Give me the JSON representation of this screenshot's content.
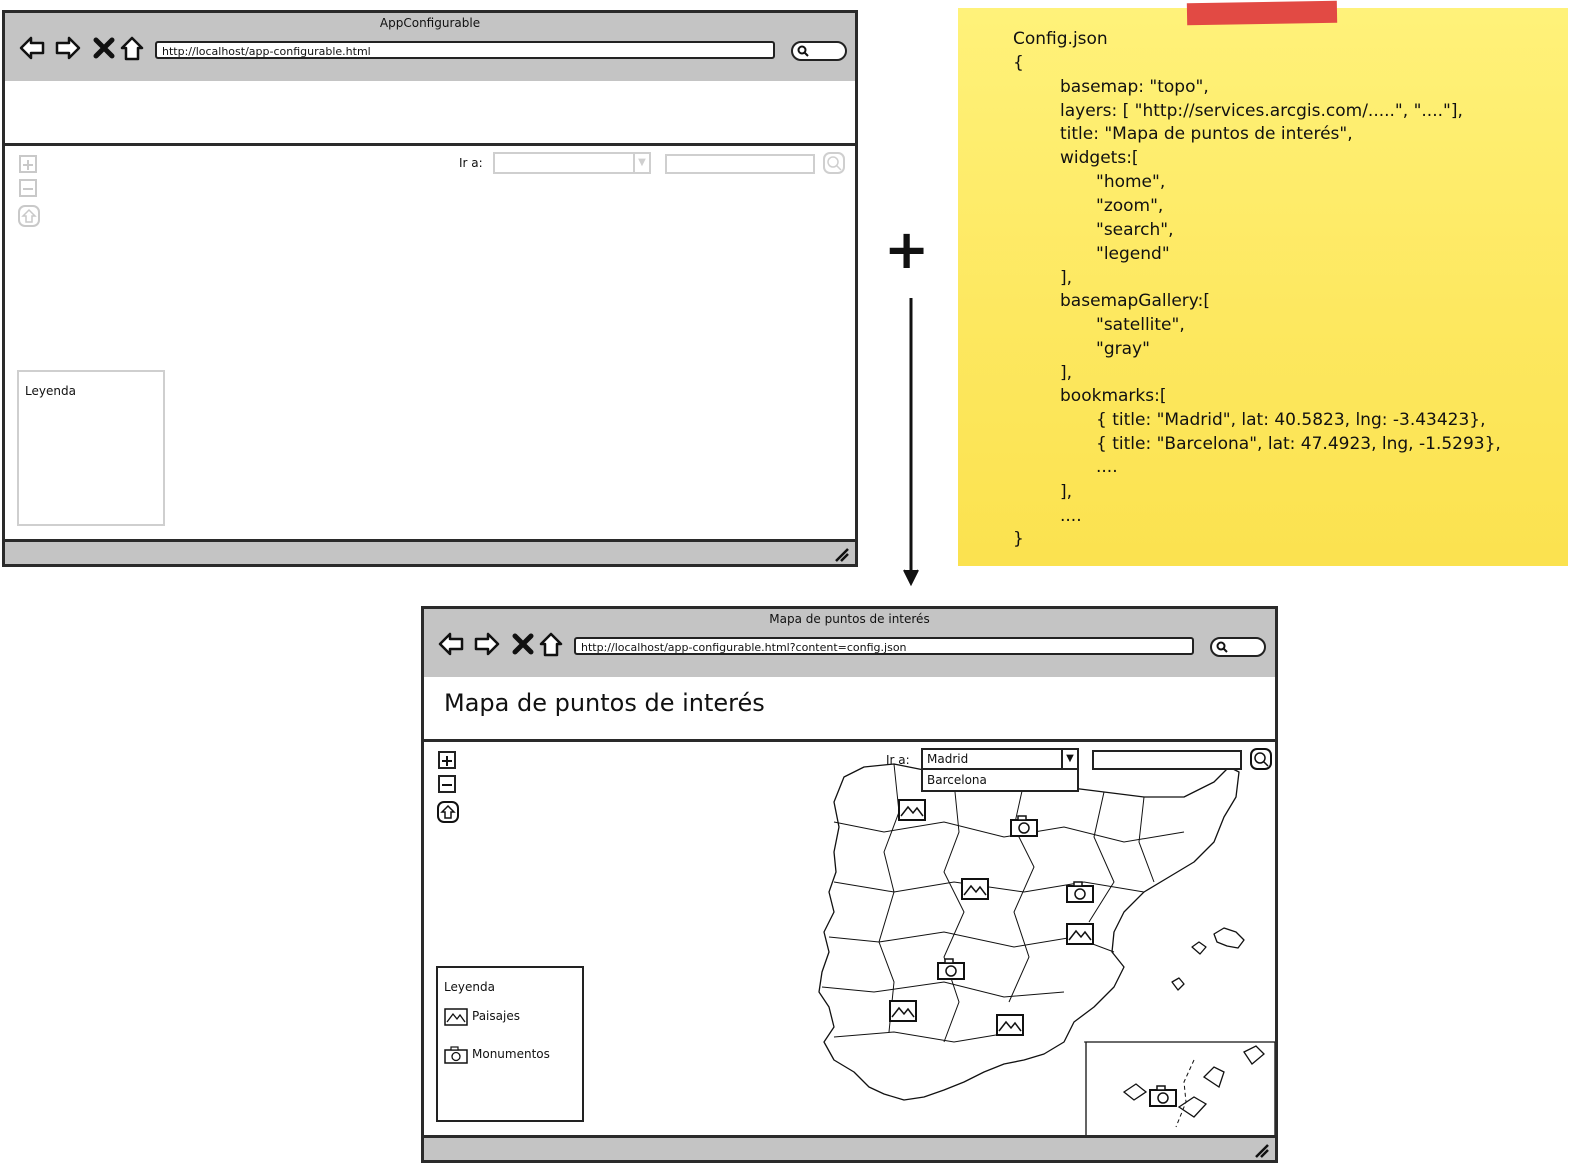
{
  "window_top": {
    "title": "AppConfigurable",
    "url": "http://localhost/app-configurable.html",
    "goto_label": "Ir a:",
    "legend_title": "Leyenda"
  },
  "config_note": {
    "lines": [
      "Config.json",
      "{",
      "basemap: \"topo\",",
      "layers: [ \"http://services.arcgis.com/.....\", \"....\"],",
      "title: \"Mapa de puntos de interés\",",
      "widgets:[",
      "\"home\",",
      "\"zoom\",",
      "\"search\",",
      "\"legend\"",
      "],",
      "basemapGallery:[",
      "\"satellite\",",
      "\"gray\"",
      "],",
      "bookmarks:[",
      "{ title: \"Madrid\", lat: 40.5823, lng: -3.43423},",
      "{ title: \"Barcelona\", lat: 47.4923, lng, -1.5293},",
      "....",
      "],",
      "....",
      "}"
    ],
    "tape_color": "#e24a44",
    "note_color": "#fde860"
  },
  "connector": {
    "plus": "+"
  },
  "window_bottom": {
    "title": "Mapa de puntos de interés",
    "url": "http://localhost/app-configurable.html?content=config.json",
    "heading": "Mapa de puntos de interés",
    "goto_label": "Ir a:",
    "bookmark_selected": "Madrid",
    "bookmark_options": [
      "Barcelona"
    ],
    "legend": {
      "title": "Leyenda",
      "items": [
        {
          "label": "Paisajes",
          "icon": "landscape-icon"
        },
        {
          "label": "Monumentos",
          "icon": "camera-icon"
        }
      ]
    },
    "map": {
      "region": "Spain provinces",
      "poi_icons": [
        "landscape-icon",
        "camera-icon"
      ]
    }
  }
}
